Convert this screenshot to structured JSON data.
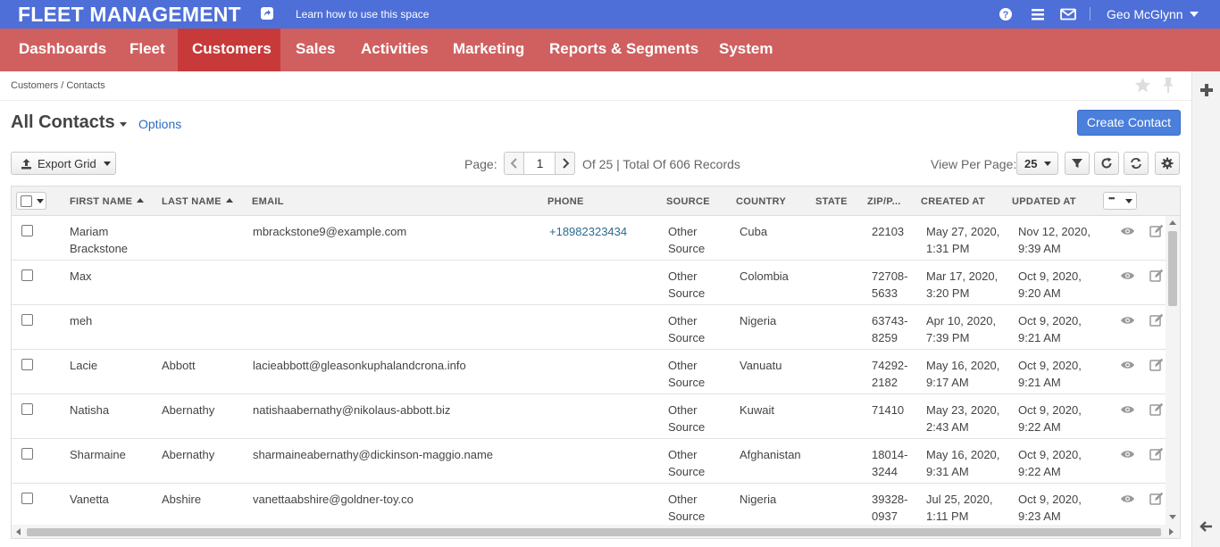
{
  "app": {
    "title": "FLEET MANAGEMENT",
    "help_link": "Learn how to use this space",
    "user_name": "Geo McGlynn"
  },
  "nav": [
    "Dashboards",
    "Fleet",
    "Customers",
    "Sales",
    "Activities",
    "Marketing",
    "Reports & Segments",
    "System"
  ],
  "breadcrumb": "Customers / Contacts",
  "page": {
    "title": "All Contacts",
    "options": "Options",
    "create_button": "Create Contact"
  },
  "toolbar": {
    "export_label": "Export Grid",
    "page_label": "Page:",
    "page_value": "1",
    "records_info": "Of 25 |  Total Of 606 Records",
    "view_per_page_label": "View Per Page:",
    "view_per_page_value": "25"
  },
  "grid": {
    "columns": [
      "FIRST NAME",
      "LAST NAME",
      "EMAIL",
      "PHONE",
      "SOURCE",
      "COUNTRY",
      "STATE",
      "ZIP/P...",
      "CREATED AT",
      "UPDATED AT"
    ],
    "actions_label": "•••",
    "rows": [
      {
        "first": "Mariam\nBrackstone",
        "last": "",
        "email": "mbrackstone9@example.com",
        "phone": "+18982323434",
        "source": "Other\nSource",
        "country": "Cuba",
        "state": "",
        "zip": "22103",
        "created": "May 27, 2020,\n1:31 PM",
        "updated": "Nov 12, 2020,\n9:39 AM"
      },
      {
        "first": "Max",
        "last": "",
        "email": "",
        "phone": "",
        "source": "Other\nSource",
        "country": "Colombia",
        "state": "",
        "zip": "72708-\n5633",
        "created": "Mar 17, 2020,\n3:20 PM",
        "updated": "Oct 9, 2020,\n9:20 AM"
      },
      {
        "first": "meh",
        "last": "",
        "email": "",
        "phone": "",
        "source": "Other\nSource",
        "country": "Nigeria",
        "state": "",
        "zip": "63743-\n8259",
        "created": "Apr 10, 2020,\n7:39 PM",
        "updated": "Oct 9, 2020,\n9:21 AM"
      },
      {
        "first": "Lacie",
        "last": "Abbott",
        "email": "lacieabbott@gleasonkuphalandcrona.info",
        "phone": "",
        "source": "Other\nSource",
        "country": "Vanuatu",
        "state": "",
        "zip": "74292-\n2182",
        "created": "May 16, 2020,\n9:17 AM",
        "updated": "Oct 9, 2020,\n9:21 AM"
      },
      {
        "first": "Natisha",
        "last": "Abernathy",
        "email": "natishaabernathy@nikolaus-abbott.biz",
        "phone": "",
        "source": "Other\nSource",
        "country": "Kuwait",
        "state": "",
        "zip": "71410",
        "created": "May 23, 2020,\n2:43 AM",
        "updated": "Oct 9, 2020,\n9:22 AM"
      },
      {
        "first": "Sharmaine",
        "last": "Abernathy",
        "email": "sharmaineabernathy@dickinson-maggio.name",
        "phone": "",
        "source": "Other\nSource",
        "country": "Afghanistan",
        "state": "",
        "zip": "18014-\n3244",
        "created": "May 16, 2020,\n9:31 AM",
        "updated": "Oct 9, 2020,\n9:22 AM"
      },
      {
        "first": "Vanetta",
        "last": "Abshire",
        "email": "vanettaabshire@goldner-toy.co",
        "phone": "",
        "source": "Other\nSource",
        "country": "Nigeria",
        "state": "",
        "zip": "39328-\n0937",
        "created": "Jul 25, 2020,\n1:11 PM",
        "updated": "Oct 9, 2020,\n9:23 AM"
      }
    ]
  }
}
